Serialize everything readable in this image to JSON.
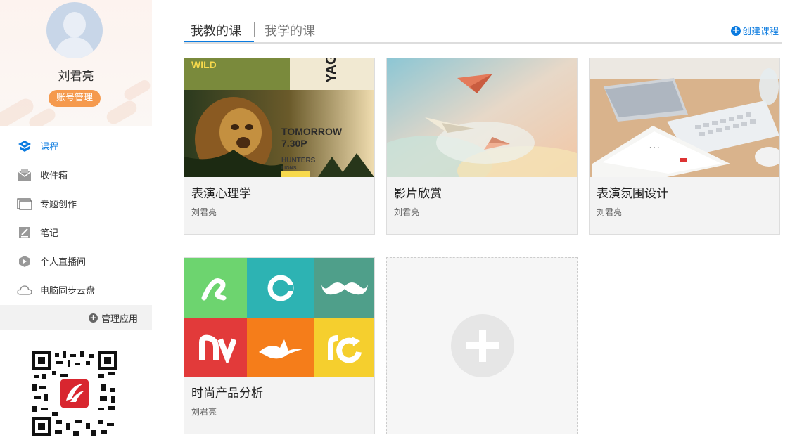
{
  "profile": {
    "name": "刘君亮",
    "account_button": "账号管理"
  },
  "nav": {
    "items": [
      {
        "label": "课程",
        "icon": "course-icon",
        "active": true
      },
      {
        "label": "收件箱",
        "icon": "inbox-icon",
        "active": false
      },
      {
        "label": "专题创作",
        "icon": "topic-icon",
        "active": false
      },
      {
        "label": "笔记",
        "icon": "note-icon",
        "active": false
      },
      {
        "label": "个人直播间",
        "icon": "live-room-icon",
        "active": false
      },
      {
        "label": "电脑同步云盘",
        "icon": "cloud-icon",
        "active": false
      }
    ],
    "manage_label": "管理应用"
  },
  "tabs": {
    "teaching": "我教的课",
    "learning": "我学的课",
    "create_label": "创建课程"
  },
  "courses": [
    {
      "title": "表演心理学",
      "author": "刘君亮"
    },
    {
      "title": "影片欣赏",
      "author": "刘君亮"
    },
    {
      "title": "表演氛围设计",
      "author": "刘君亮"
    },
    {
      "title": "时尚产品分析",
      "author": "刘君亮"
    }
  ],
  "thumb_text": {
    "wild": "WILD",
    "tomorrow": "TOMORROW",
    "time": "7.30P",
    "hunters": "HUNTERS",
    "lions": "LIONS"
  },
  "colors": {
    "accent": "#0b7be0",
    "badge": "#f59a4e"
  }
}
